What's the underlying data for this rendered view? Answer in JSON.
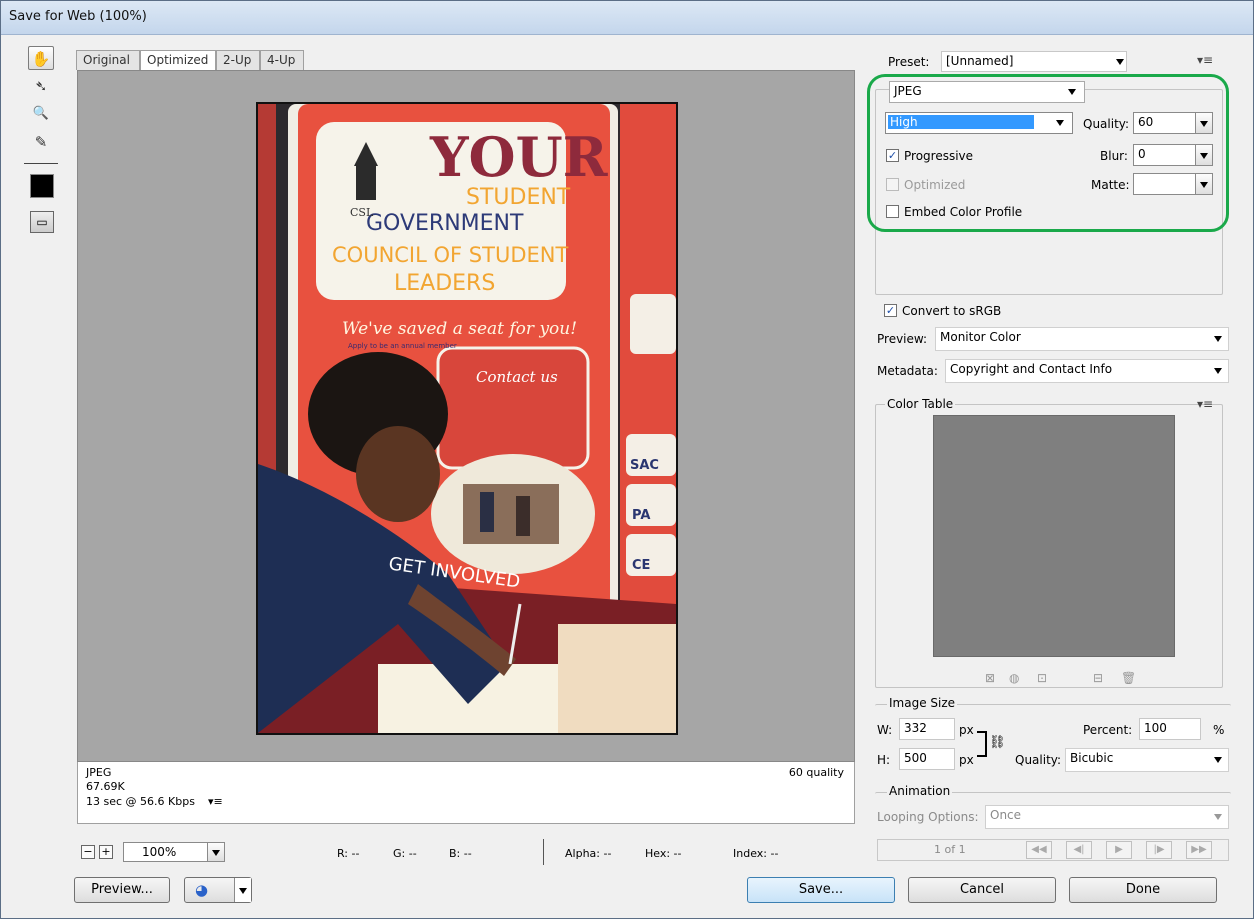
{
  "window": {
    "title": "Save for Web (100%)"
  },
  "tools": [
    {
      "name": "hand-tool-icon",
      "glyph": "✋"
    },
    {
      "name": "slice-select-tool-icon",
      "glyph": "➴"
    },
    {
      "name": "zoom-tool-icon",
      "glyph": "🔍"
    },
    {
      "name": "eyedropper-tool-icon",
      "glyph": "✎"
    }
  ],
  "view": {
    "tabs": [
      "Original",
      "Optimized",
      "2-Up",
      "4-Up"
    ],
    "active_tab": "Optimized"
  },
  "poster": {
    "title_line1": "YOUR",
    "title_line2": "STUDENT",
    "title_line3": "GOVERNMENT",
    "title_line4": "COUNCIL OF STUDENT",
    "title_line5": "LEADERS",
    "logo_text": "CSL",
    "tagline": "We've saved a seat for you!",
    "subtagline": "Apply to be an annual member",
    "contact": "Contact us",
    "get_involved": "GET INVOLVED",
    "side_words": [
      "SAC",
      "PA",
      "CE"
    ]
  },
  "info": {
    "format": "JPEG",
    "size": "67.69K",
    "time": "13 sec @ 56.6 Kbps",
    "quality_label": "60 quality",
    "menu_glyph": "▾≡"
  },
  "status": {
    "zoom": "100%",
    "r": "R: --",
    "g": "G: --",
    "b": "B: --",
    "alpha": "Alpha: --",
    "hex": "Hex: --",
    "index": "Index: --"
  },
  "settings": {
    "preset_label": "Preset:",
    "preset_value": "[Unnamed]",
    "format": "JPEG",
    "compression": "High",
    "quality_label": "Quality:",
    "quality_value": "60",
    "blur_label": "Blur:",
    "blur_value": "0",
    "matte_label": "Matte:",
    "matte_value": "",
    "progressive": "Progressive",
    "optimized": "Optimized",
    "embed_profile": "Embed Color Profile",
    "convert_srgb": "Convert to sRGB",
    "preview_label": "Preview:",
    "preview_value": "Monitor Color",
    "metadata_label": "Metadata:",
    "metadata_value": "Copyright and Contact Info",
    "checkmark": "✓",
    "panel_menu": "▾≡"
  },
  "color_table": {
    "label": "Color Table",
    "swatch_color": "#7f7f7f"
  },
  "image_size": {
    "label": "Image Size",
    "w_label": "W:",
    "w_value": "332",
    "h_label": "H:",
    "h_value": "500",
    "px": "px",
    "percent_label": "Percent:",
    "percent_value": "100",
    "percent_sign": "%",
    "quality_label": "Quality:",
    "quality_value": "Bicubic"
  },
  "animation": {
    "label": "Animation",
    "looping_label": "Looping Options:",
    "looping_value": "Once",
    "frame": "1 of 1"
  },
  "buttons": {
    "preview": "Preview...",
    "save": "Save...",
    "cancel": "Cancel",
    "done": "Done"
  },
  "colors": {
    "highlight": "#1aa94a",
    "selection_blue": "#3399ff",
    "poster_red": "#e8513f"
  }
}
